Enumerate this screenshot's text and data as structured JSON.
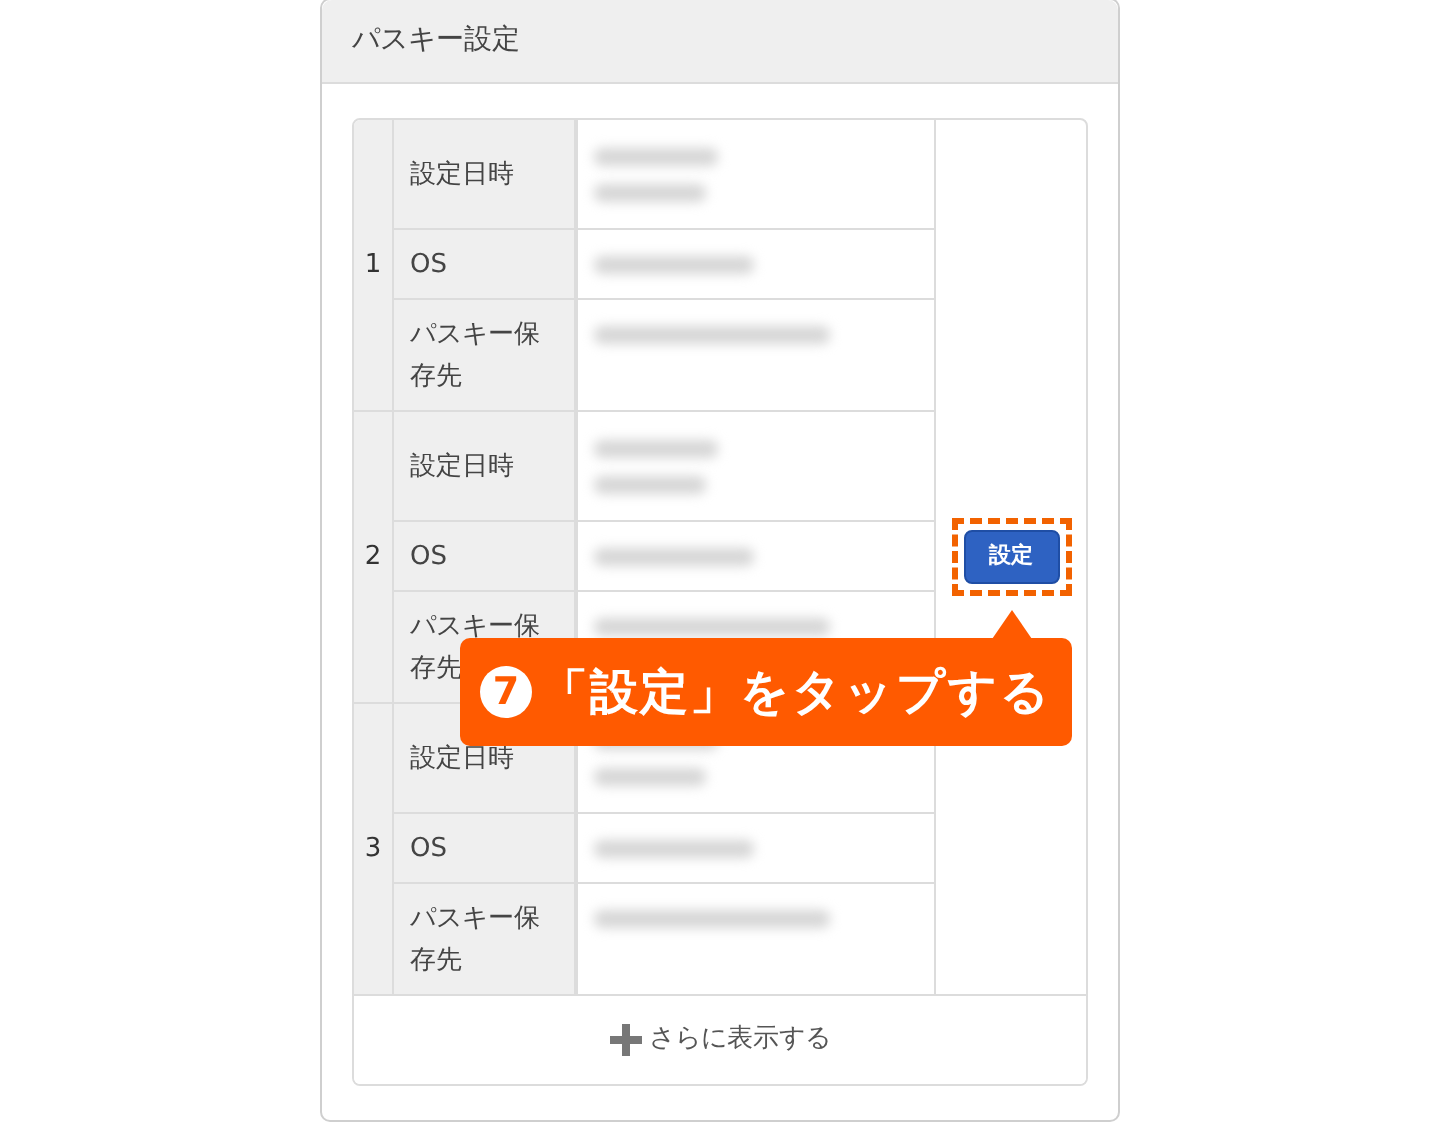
{
  "panel": {
    "title": "パスキー設定"
  },
  "passkeys": [
    {
      "index": "1",
      "fields": [
        {
          "kind": "datetime",
          "label": "設定日時"
        },
        {
          "kind": "os",
          "label": "OS"
        },
        {
          "kind": "storage",
          "label": "パスキー保存先"
        }
      ]
    },
    {
      "index": "2",
      "fields": [
        {
          "kind": "datetime",
          "label": "設定日時"
        },
        {
          "kind": "os",
          "label": "OS"
        },
        {
          "kind": "storage",
          "label": "パスキー保存先"
        }
      ]
    },
    {
      "index": "3",
      "fields": [
        {
          "kind": "datetime",
          "label": "設定日時"
        },
        {
          "kind": "os",
          "label": "OS"
        },
        {
          "kind": "storage",
          "label": "パスキー保存先"
        }
      ]
    }
  ],
  "settings_button": {
    "label": "設定"
  },
  "more_button": {
    "label": "さらに表示する"
  },
  "callout": {
    "step": "7",
    "text": "「設定」をタップする"
  }
}
